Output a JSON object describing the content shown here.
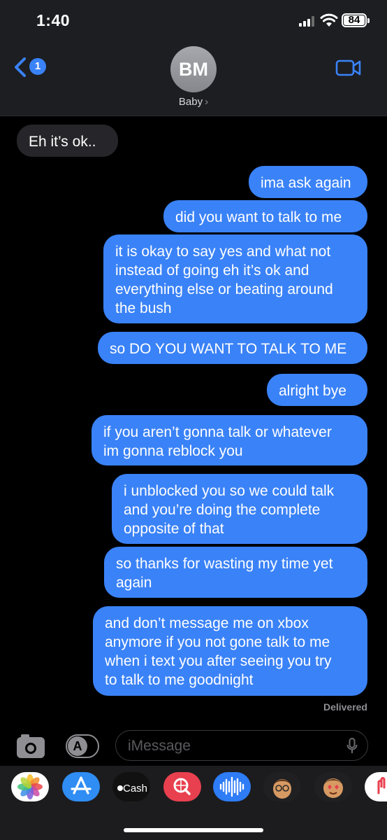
{
  "status_bar": {
    "time": "1:40",
    "battery": "84"
  },
  "header": {
    "unread_count": "1",
    "avatar_initials": "BM",
    "contact_name": "Baby",
    "chevron": "›"
  },
  "messages": [
    {
      "dir": "in",
      "text": "Eh it’s ok.."
    },
    {
      "dir": "out",
      "text": "ima ask again"
    },
    {
      "dir": "out",
      "text": "did you want to talk to me"
    },
    {
      "dir": "out",
      "lines": [
        "it is okay to say yes and what not",
        "instead of going eh it’s ok and",
        "everything else or beating around",
        "the bush"
      ]
    },
    {
      "dir": "out",
      "text": "so DO YOU WANT TO TALK TO ME"
    },
    {
      "dir": "out",
      "text": "alright bye"
    },
    {
      "dir": "out",
      "lines": [
        "if you aren’t gonna talk or whatever",
        "im gonna reblock you"
      ]
    },
    {
      "dir": "out",
      "lines": [
        "i unblocked you so we could talk",
        "and you’re doing the complete",
        "opposite of that"
      ]
    },
    {
      "dir": "out",
      "lines": [
        "so thanks for wasting my time yet",
        "again"
      ]
    },
    {
      "dir": "out",
      "lines": [
        "and don’t message me on xbox",
        "anymore if you not gone talk to me",
        "when i text you after seeing you try",
        "to talk to me goodnight"
      ]
    }
  ],
  "delivered_label": "Delivered",
  "compose": {
    "placeholder": "iMessage",
    "apps_glyph": "A"
  },
  "drawer_apps": [
    {
      "name": "photos-app-icon"
    },
    {
      "name": "app-store-app-icon"
    },
    {
      "name": "apple-cash-app-icon",
      "label": "Cash"
    },
    {
      "name": "web-search-app-icon"
    },
    {
      "name": "audio-message-app-icon"
    },
    {
      "name": "memoji-app-icon"
    },
    {
      "name": "memoji-stickers-app-icon"
    },
    {
      "name": "digital-touch-app-icon"
    }
  ],
  "colors": {
    "outgoing": "#3a82f7",
    "incoming": "#26262a",
    "background": "#000000",
    "header": "#1c1e22"
  }
}
